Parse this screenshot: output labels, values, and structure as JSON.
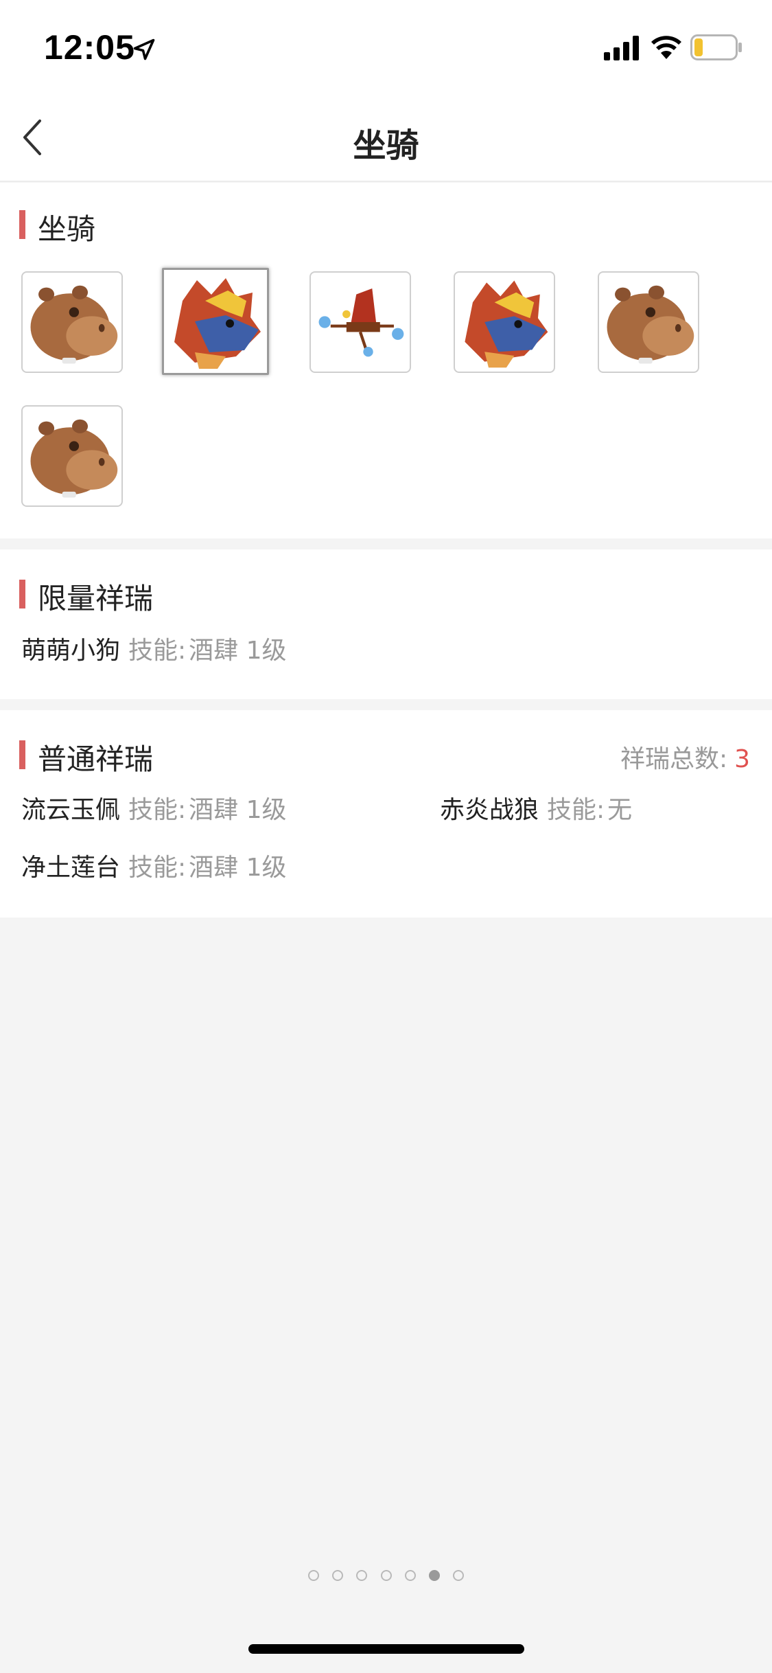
{
  "status_bar": {
    "time": "12:05",
    "icons": [
      "location-arrow-icon",
      "cellular-signal-icon",
      "wifi-icon",
      "battery-low-icon"
    ]
  },
  "nav": {
    "title": "坐骑",
    "back_icon": "chevron-left-icon"
  },
  "mount_section": {
    "title": "坐骑",
    "mounts": [
      {
        "kind": "hippo",
        "selected": false
      },
      {
        "kind": "wolf",
        "selected": true
      },
      {
        "kind": "cloud-seat",
        "selected": false
      },
      {
        "kind": "wolf",
        "selected": false
      },
      {
        "kind": "hippo",
        "selected": false
      },
      {
        "kind": "hippo",
        "selected": false
      }
    ]
  },
  "limited_section": {
    "title": "限量祥瑞",
    "items": [
      {
        "name": "萌萌小狗",
        "skill_label": "技能:",
        "skill_value": "酒肆 1级"
      }
    ]
  },
  "normal_section": {
    "title": "普通祥瑞",
    "total_label": "祥瑞总数:",
    "total_value": "3",
    "items": [
      {
        "name": "流云玉佩",
        "skill_label": "技能:",
        "skill_value": "酒肆 1级"
      },
      {
        "name": "赤炎战狼",
        "skill_label": "技能:",
        "skill_value": "无"
      },
      {
        "name": "净土莲台",
        "skill_label": "技能:",
        "skill_value": "酒肆 1级"
      }
    ]
  },
  "pager": {
    "count": 7,
    "active_index": 5
  },
  "colors": {
    "accent_bar": "#d9605f",
    "total_value": "#e0514f",
    "muted_text": "#9a9a9a",
    "background": "#f4f4f4"
  }
}
